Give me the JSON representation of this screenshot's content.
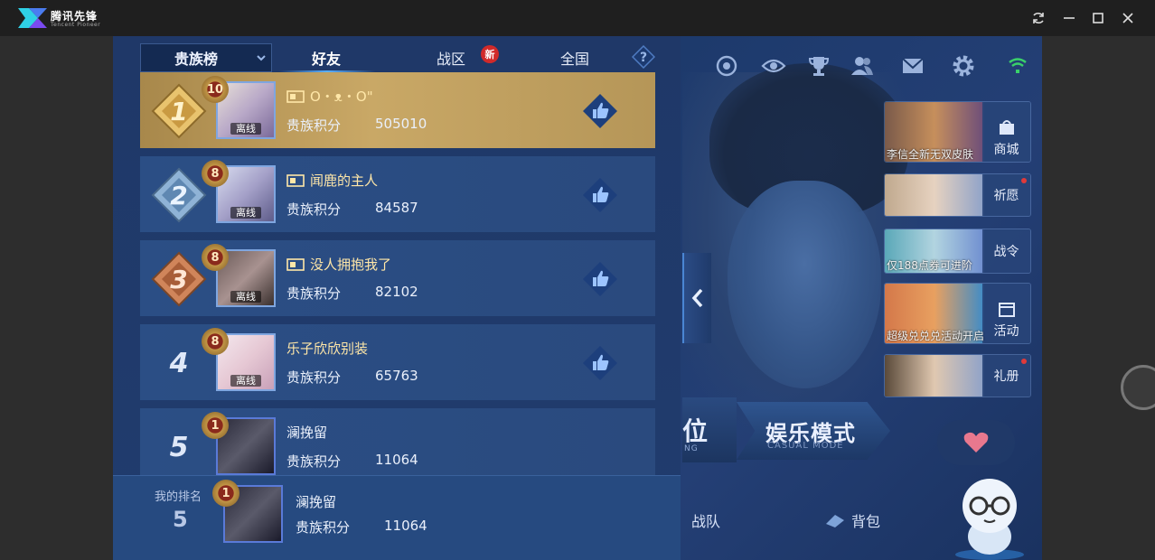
{
  "window": {
    "app_name": "腾讯先锋",
    "app_sub": "Tencent Pioneer",
    "controls": [
      "refresh-icon",
      "minimize-icon",
      "maximize-icon",
      "close-icon"
    ]
  },
  "leaderboard": {
    "dropdown": "贵族榜",
    "tabs": [
      {
        "label": "好友",
        "active": true
      },
      {
        "label": "战区",
        "active": false,
        "badge": "新"
      },
      {
        "label": "全国",
        "active": false
      }
    ],
    "help_icon": "question-icon",
    "rows": [
      {
        "rank": "1",
        "level": "10",
        "name": "O・ᴥ・O\"",
        "has_flag": true,
        "score_label": "贵族积分",
        "score": "505010",
        "status": "离线"
      },
      {
        "rank": "2",
        "level": "8",
        "name": "闻鹿的主人",
        "has_flag": true,
        "score_label": "贵族积分",
        "score": "84587",
        "status": "离线"
      },
      {
        "rank": "3",
        "level": "8",
        "name": "没人拥抱我了",
        "has_flag": true,
        "score_label": "贵族积分",
        "score": "82102",
        "status": "离线"
      },
      {
        "rank": "4",
        "level": "8",
        "name": "乐子欣欣别装",
        "has_flag": false,
        "score_label": "贵族积分",
        "score": "65763",
        "status": "离线"
      },
      {
        "rank": "5",
        "level": "1",
        "name": "澜挽留",
        "has_flag": false,
        "score_label": "贵族积分",
        "score": "11064",
        "status": ""
      }
    ],
    "mine": {
      "label": "我的排名",
      "rank": "5",
      "level": "1",
      "name": "澜挽留",
      "score_label": "贵族积分",
      "score": "11064"
    }
  },
  "game": {
    "top_icons": [
      "crossed-swords-icon",
      "target-icon",
      "eye-icon",
      "trophy-icon",
      "friends-icon",
      "mail-icon",
      "gear-icon",
      "wifi-signal-icon"
    ],
    "tiles": [
      {
        "label": "商城",
        "caption": "李信全新无双皮肤"
      },
      {
        "label": "祈愿",
        "caption": ""
      },
      {
        "label": "战令",
        "caption": "仅188点券可进阶"
      },
      {
        "label": "活动",
        "caption": "超级兑兑兑活动开启"
      },
      {
        "label": "礼册",
        "caption": ""
      }
    ],
    "mode_rank": "位",
    "mode_rank_sub": "NG",
    "mode_casual": "娱乐模式",
    "mode_casual_sub": "CASUAL MODE",
    "nav": [
      {
        "label": "战队"
      },
      {
        "label": "背包"
      }
    ]
  },
  "colors": {
    "gold_row": "#c9a866",
    "panel": "#1f3868",
    "accent": "#5ab0ff",
    "name_gold": "#ffe7a8"
  }
}
